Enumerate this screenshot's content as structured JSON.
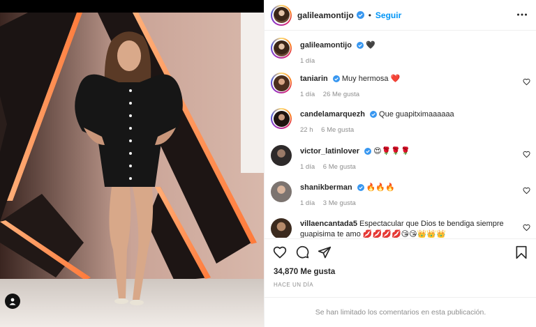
{
  "post": {
    "author": "galileamontijo",
    "follow_label": "Seguir",
    "separator": "•"
  },
  "caption": {
    "user": "galileamontijo",
    "emoji": "🖤",
    "time": "1 día"
  },
  "comments": [
    {
      "user": "taniarin",
      "verified": true,
      "text": "Muy hermosa ❤️",
      "time": "1 día",
      "likes": "26 Me gusta"
    },
    {
      "user": "candelamarquezh",
      "verified": true,
      "text": "Que guapitximaaaaaa",
      "time": "22 h",
      "likes": "6 Me gusta"
    },
    {
      "user": "victor_latinlover",
      "verified": true,
      "text": "😍🌹🌹🌹",
      "time": "1 día",
      "likes": "6 Me gusta"
    },
    {
      "user": "shanikberman",
      "verified": true,
      "text": "🔥🔥🔥",
      "time": "1 día",
      "likes": "3 Me gusta"
    },
    {
      "user": "villaencantada5",
      "verified": false,
      "text": "Espectacular que Dios te bendiga siempre guapisima te amo 💋💋💋💋😘😘👑👑👑",
      "time": "",
      "likes": ""
    }
  ],
  "stats": {
    "likes": "34,870 Me gusta",
    "date": "HACE UN DÍA"
  },
  "footer": {
    "notice": "Se han limitado los comentarios en esta publicación."
  },
  "icons": {
    "like": "heart-outline-icon",
    "comment": "comment-bubble-icon",
    "share": "paper-plane-icon",
    "save": "bookmark-icon",
    "more": "more-dots-icon",
    "user_tag": "person-tag-icon",
    "verified": "verified-badge-icon"
  },
  "colors": {
    "accent": "#0095f6",
    "verified": "#3897f0",
    "muted": "#8e8e8e",
    "heart_red": "#ed4956"
  }
}
